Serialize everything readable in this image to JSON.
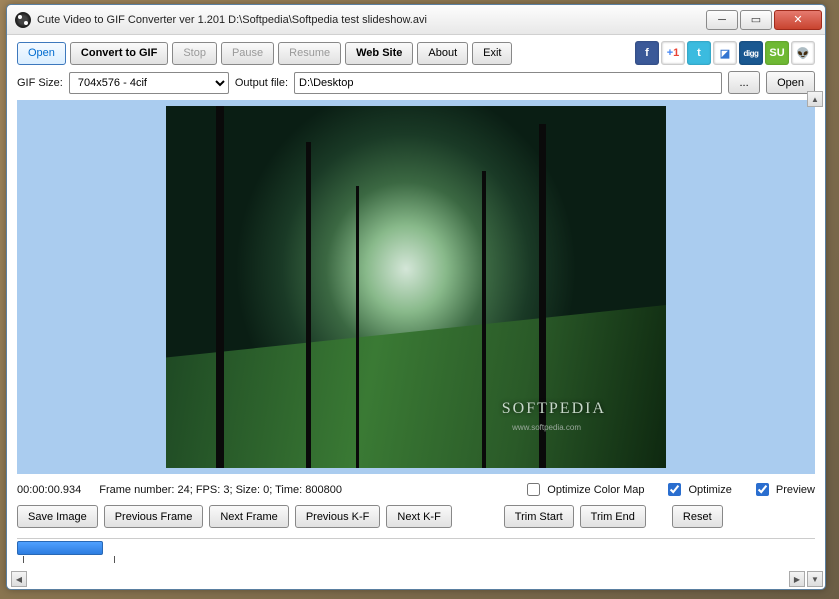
{
  "window": {
    "title": "Cute Video to GIF Converter ver 1.201  D:\\Softpedia\\Softpedia test slideshow.avi"
  },
  "toolbar": {
    "open": "Open",
    "convert": "Convert to GIF",
    "stop": "Stop",
    "pause": "Pause",
    "resume": "Resume",
    "website": "Web Site",
    "about": "About",
    "exit": "Exit"
  },
  "row2": {
    "gif_size_label": "GIF Size:",
    "gif_size_value": "704x576 - 4cif",
    "output_label": "Output file:",
    "output_value": "D:\\Desktop",
    "browse": "...",
    "open": "Open"
  },
  "preview": {
    "watermark": "SOFTPEDIA",
    "sub": "www.softpedia.com"
  },
  "status": {
    "timecode": "00:00:00.934",
    "frame_info": "Frame number: 24; FPS: 3; Size: 0; Time: 800800",
    "opt_colormap": "Optimize Color Map",
    "optimize": "Optimize",
    "preview": "Preview",
    "opt_colormap_checked": false,
    "optimize_checked": true,
    "preview_checked": true
  },
  "btns": {
    "save_image": "Save Image",
    "prev_frame": "Previous Frame",
    "next_frame": "Next Frame",
    "prev_kf": "Previous K-F",
    "next_kf": "Next K-F",
    "trim_start": "Trim Start",
    "trim_end": "Trim End",
    "reset": "Reset"
  }
}
